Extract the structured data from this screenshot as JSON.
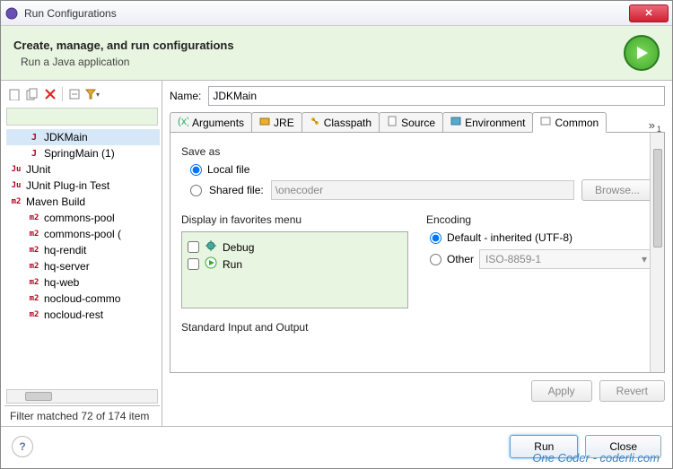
{
  "window": {
    "title": "Run Configurations"
  },
  "banner": {
    "title": "Create, manage, and run configurations",
    "subtitle": "Run a Java application"
  },
  "left": {
    "tree": [
      {
        "label": "JDKMain",
        "indent": 1,
        "iconClass": "icon-j",
        "iconText": "J",
        "selected": true
      },
      {
        "label": "SpringMain (1)",
        "indent": 1,
        "iconClass": "icon-j",
        "iconText": "J"
      },
      {
        "label": "JUnit",
        "indent": 0,
        "iconClass": "icon-ju",
        "iconText": "Ju"
      },
      {
        "label": "JUnit Plug-in Test",
        "indent": 0,
        "iconClass": "icon-ju",
        "iconText": "Ju"
      },
      {
        "label": "Maven Build",
        "indent": 0,
        "iconClass": "icon-m2",
        "iconText": "m2"
      },
      {
        "label": "commons-pool",
        "indent": 1,
        "iconClass": "icon-m2",
        "iconText": "m2"
      },
      {
        "label": "commons-pool (",
        "indent": 1,
        "iconClass": "icon-m2",
        "iconText": "m2"
      },
      {
        "label": "hq-rendit",
        "indent": 1,
        "iconClass": "icon-m2",
        "iconText": "m2"
      },
      {
        "label": "hq-server",
        "indent": 1,
        "iconClass": "icon-m2",
        "iconText": "m2"
      },
      {
        "label": "hq-web",
        "indent": 1,
        "iconClass": "icon-m2",
        "iconText": "m2"
      },
      {
        "label": "nocloud-commo",
        "indent": 1,
        "iconClass": "icon-m2",
        "iconText": "m2"
      },
      {
        "label": "nocloud-rest",
        "indent": 1,
        "iconClass": "icon-m2",
        "iconText": "m2"
      }
    ],
    "filter_status": "Filter matched 72 of 174 item"
  },
  "right": {
    "name_label": "Name:",
    "name_value": "JDKMain",
    "tabs": [
      "Arguments",
      "JRE",
      "Classpath",
      "Source",
      "Environment",
      "Common"
    ],
    "save_as_label": "Save as",
    "local_file_label": "Local file",
    "shared_file_label": "Shared file:",
    "shared_file_value": "\\onecoder",
    "browse_label": "Browse...",
    "favorites_label": "Display in favorites menu",
    "fav_debug": "Debug",
    "fav_run": "Run",
    "encoding_label": "Encoding",
    "enc_default": "Default - inherited (UTF-8)",
    "enc_other": "Other",
    "enc_other_value": "ISO-8859-1",
    "stdio_label": "Standard Input and Output",
    "apply_label": "Apply",
    "revert_label": "Revert"
  },
  "footer": {
    "run_label": "Run",
    "close_label": "Close"
  },
  "watermark": "One Coder - coderli.com"
}
